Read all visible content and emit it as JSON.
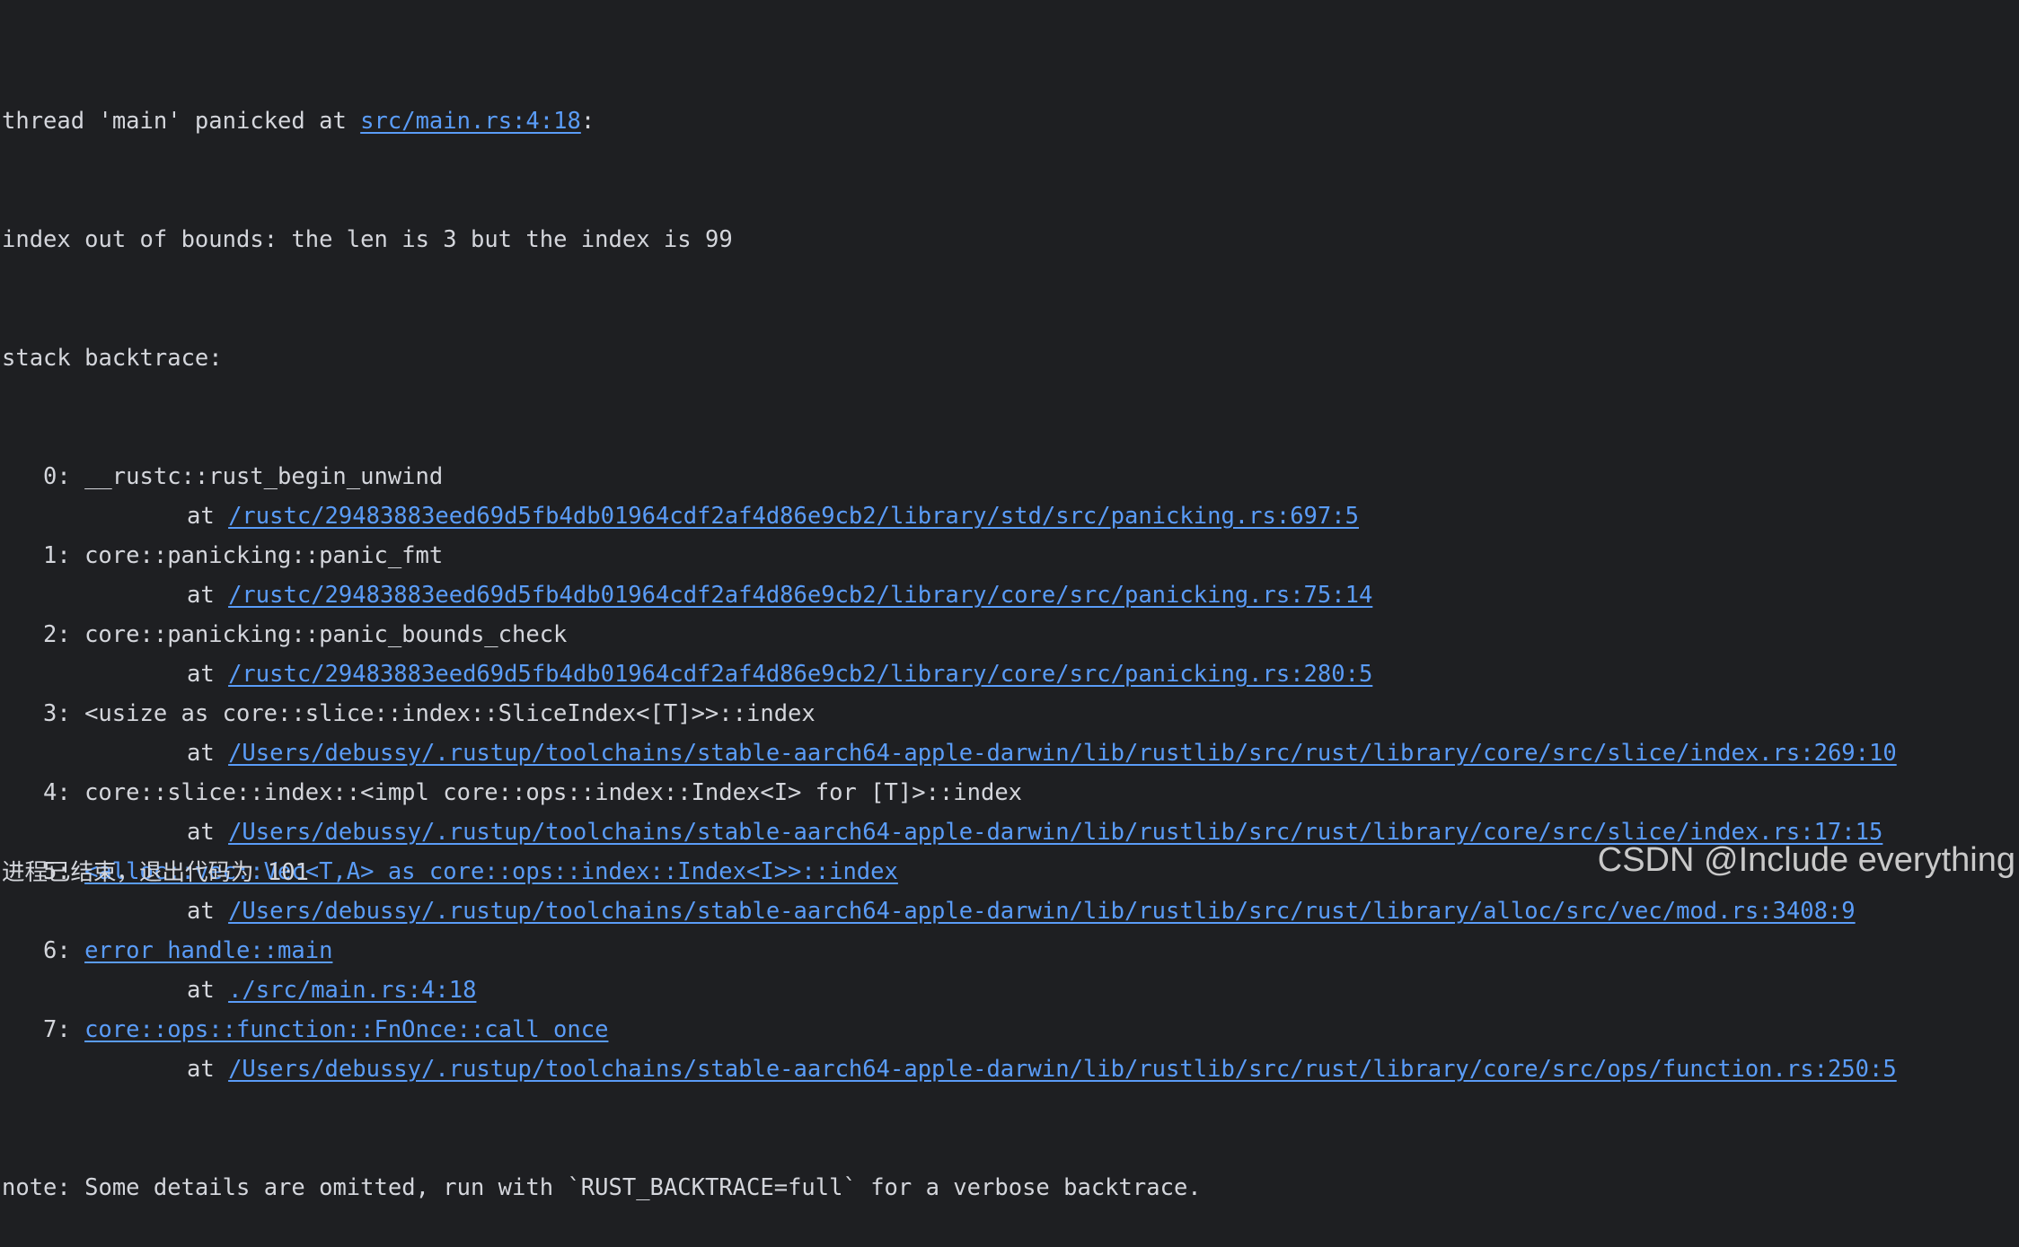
{
  "panic": {
    "prefix": "thread 'main' panicked at ",
    "location": "src/main.rs:4:18",
    "suffix": ":",
    "message": "index out of bounds: the len is 3 but the index is 99",
    "backtrace_header": "stack backtrace:"
  },
  "frames": [
    {
      "index": "0:",
      "symbol": "__rustc::rust_begin_unwind",
      "symbol_linked": false,
      "at": "at",
      "path": "/rustc/29483883eed69d5fb4db01964cdf2af4d86e9cb2/library/std/src/panicking.rs:697:5"
    },
    {
      "index": "1:",
      "symbol": "core::panicking::panic_fmt",
      "symbol_linked": false,
      "at": "at",
      "path": "/rustc/29483883eed69d5fb4db01964cdf2af4d86e9cb2/library/core/src/panicking.rs:75:14"
    },
    {
      "index": "2:",
      "symbol": "core::panicking::panic_bounds_check",
      "symbol_linked": false,
      "at": "at",
      "path": "/rustc/29483883eed69d5fb4db01964cdf2af4d86e9cb2/library/core/src/panicking.rs:280:5"
    },
    {
      "index": "3:",
      "symbol": "<usize as core::slice::index::SliceIndex<[T]>>::index",
      "symbol_linked": false,
      "at": "at",
      "path": "/Users/debussy/.rustup/toolchains/stable-aarch64-apple-darwin/lib/rustlib/src/rust/library/core/src/slice/index.rs:269:10"
    },
    {
      "index": "4:",
      "symbol": "core::slice::index::<impl core::ops::index::Index<I> for [T]>::index",
      "symbol_linked": false,
      "at": "at",
      "path": "/Users/debussy/.rustup/toolchains/stable-aarch64-apple-darwin/lib/rustlib/src/rust/library/core/src/slice/index.rs:17:15"
    },
    {
      "index": "5:",
      "symbol": "<alloc::vec::Vec<T,A> as core::ops::index::Index<I>>::index",
      "symbol_linked": true,
      "at": "at",
      "path": "/Users/debussy/.rustup/toolchains/stable-aarch64-apple-darwin/lib/rustlib/src/rust/library/alloc/src/vec/mod.rs:3408:9"
    },
    {
      "index": "6:",
      "symbol": "error_handle::main",
      "symbol_linked": true,
      "at": "at",
      "path": "./src/main.rs:4:18"
    },
    {
      "index": "7:",
      "symbol": "core::ops::function::FnOnce::call_once",
      "symbol_linked": true,
      "at": "at",
      "path": "/Users/debussy/.rustup/toolchains/stable-aarch64-apple-darwin/lib/rustlib/src/rust/library/core/src/ops/function.rs:250:5"
    }
  ],
  "note": "note: Some details are omitted, run with `RUST_BACKTRACE=full` for a verbose backtrace.",
  "exit_message": "进程已结束，退出代码为 101",
  "watermark": "CSDN @Include everything",
  "colors": {
    "background": "#1e1f22",
    "text": "#d4d6dc",
    "link": "#5a9cf8"
  }
}
